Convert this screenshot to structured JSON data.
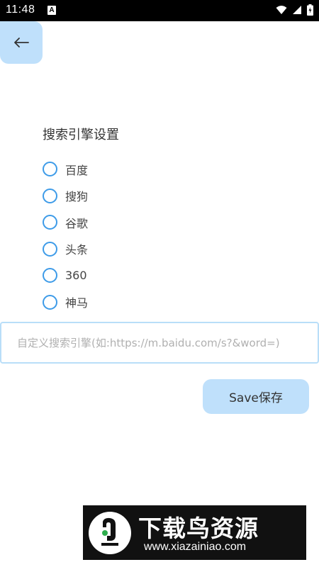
{
  "status_bar": {
    "time": "11:48",
    "notification_letter": "A",
    "icons": [
      "wifi-icon",
      "signal-icon",
      "battery-icon"
    ]
  },
  "back_button": {
    "icon": "arrow-left-icon"
  },
  "settings": {
    "title": "搜索引擎设置",
    "options": [
      {
        "label": "百度",
        "selected": false
      },
      {
        "label": "搜狗",
        "selected": false
      },
      {
        "label": "谷歌",
        "selected": false
      },
      {
        "label": "头条",
        "selected": false
      },
      {
        "label": "360",
        "selected": false
      },
      {
        "label": "神马",
        "selected": false
      }
    ]
  },
  "custom_engine": {
    "placeholder": "自定义搜索引擎(如:https://m.baidu.com/s?&word=)",
    "value": ""
  },
  "save_button": {
    "label": "Save保存"
  },
  "watermark": {
    "title": "下载鸟资源",
    "url": "www.xiazainiao.com"
  },
  "colors": {
    "accent": "#3d9be8",
    "button_bg": "#bfe0fb",
    "input_border": "#b9def8",
    "status_bar": "#000000"
  }
}
